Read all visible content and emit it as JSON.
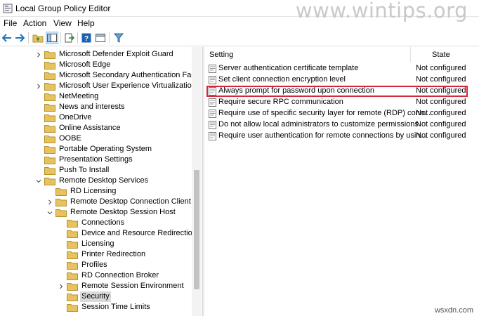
{
  "window": {
    "title": "Local Group Policy Editor",
    "watermark": "www.wintips.org",
    "footer_watermark": "wsxdn.com"
  },
  "menu": [
    "File",
    "Action",
    "View",
    "Help"
  ],
  "tree": [
    {
      "label": "Microsoft Defender Exploit Guard",
      "depth": 1,
      "expander": "collapsed"
    },
    {
      "label": "Microsoft Edge",
      "depth": 1,
      "expander": "none"
    },
    {
      "label": "Microsoft Secondary Authentication Factor",
      "depth": 1,
      "expander": "none"
    },
    {
      "label": "Microsoft User Experience Virtualization",
      "depth": 1,
      "expander": "collapsed"
    },
    {
      "label": "NetMeeting",
      "depth": 1,
      "expander": "none"
    },
    {
      "label": "News and interests",
      "depth": 1,
      "expander": "none"
    },
    {
      "label": "OneDrive",
      "depth": 1,
      "expander": "none"
    },
    {
      "label": "Online Assistance",
      "depth": 1,
      "expander": "none"
    },
    {
      "label": "OOBE",
      "depth": 1,
      "expander": "none"
    },
    {
      "label": "Portable Operating System",
      "depth": 1,
      "expander": "none"
    },
    {
      "label": "Presentation Settings",
      "depth": 1,
      "expander": "none"
    },
    {
      "label": "Push To Install",
      "depth": 1,
      "expander": "none"
    },
    {
      "label": "Remote Desktop Services",
      "depth": 1,
      "expander": "expanded"
    },
    {
      "label": "RD Licensing",
      "depth": 2,
      "expander": "none"
    },
    {
      "label": "Remote Desktop Connection Client",
      "depth": 2,
      "expander": "collapsed"
    },
    {
      "label": "Remote Desktop Session Host",
      "depth": 2,
      "expander": "expanded"
    },
    {
      "label": "Connections",
      "depth": 3,
      "expander": "none"
    },
    {
      "label": "Device and Resource Redirection",
      "depth": 3,
      "expander": "none"
    },
    {
      "label": "Licensing",
      "depth": 3,
      "expander": "none"
    },
    {
      "label": "Printer Redirection",
      "depth": 3,
      "expander": "none"
    },
    {
      "label": "Profiles",
      "depth": 3,
      "expander": "none"
    },
    {
      "label": "RD Connection Broker",
      "depth": 3,
      "expander": "none"
    },
    {
      "label": "Remote Session Environment",
      "depth": 3,
      "expander": "collapsed"
    },
    {
      "label": "Security",
      "depth": 3,
      "expander": "none",
      "selected": true
    },
    {
      "label": "Session Time Limits",
      "depth": 3,
      "expander": "none"
    }
  ],
  "list": {
    "columns": {
      "setting": "Setting",
      "state": "State"
    },
    "rows": [
      {
        "setting": "Server authentication certificate template",
        "state": "Not configured"
      },
      {
        "setting": "Set client connection encryption level",
        "state": "Not configured"
      },
      {
        "setting": "Always prompt for password upon connection",
        "state": "Not configured",
        "highlighted": true
      },
      {
        "setting": "Require secure RPC communication",
        "state": "Not configured"
      },
      {
        "setting": "Require use of specific security layer for remote (RDP) conn...",
        "state": "Not configured"
      },
      {
        "setting": "Do not allow local administrators to customize permissions",
        "state": "Not configured"
      },
      {
        "setting": "Require user authentication for remote connections by usin...",
        "state": "Not configured"
      }
    ]
  },
  "colors": {
    "highlight_border": "#d12a3c",
    "folder": "#e8c25f",
    "selected_bg": "#dadada"
  }
}
